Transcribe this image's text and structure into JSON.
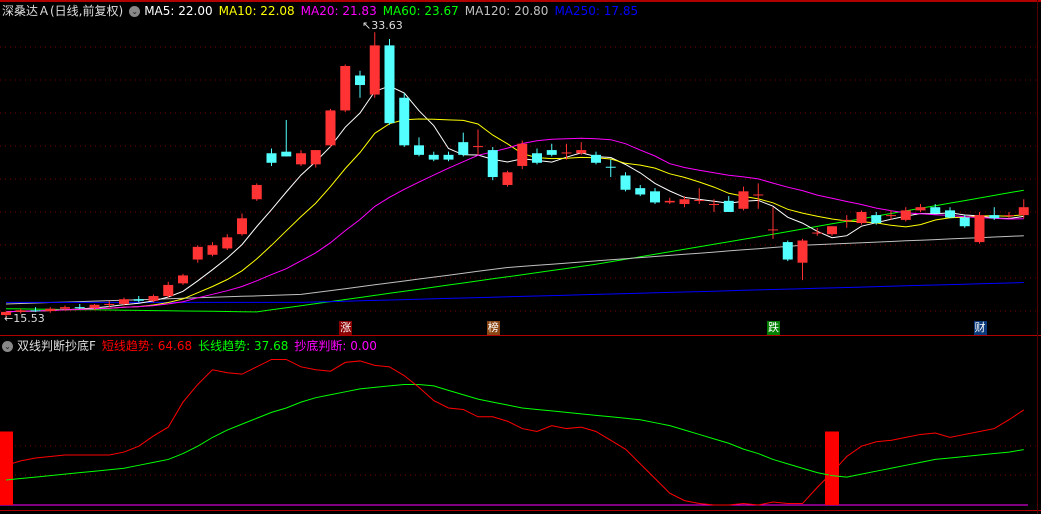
{
  "header": {
    "title": "深桑达Ａ(日线,前复权)",
    "ma": [
      {
        "label": "MA5: 22.00",
        "color": "#ffffff"
      },
      {
        "label": "MA10: 22.08",
        "color": "#ffff00"
      },
      {
        "label": "MA20: 21.83",
        "color": "#ff00ff"
      },
      {
        "label": "MA60: 23.67",
        "color": "#00ff00"
      },
      {
        "label": "MA120: 20.80",
        "color": "#c0c0c0"
      },
      {
        "label": "MA250: 17.85",
        "color": "#0000ff"
      }
    ]
  },
  "price_marks": {
    "high": "33.63",
    "low": "15.53"
  },
  "badges": [
    {
      "label": "涨",
      "color": "#8b0000",
      "index": 23
    },
    {
      "label": "榜",
      "color": "#8b4513",
      "index": 33
    },
    {
      "label": "跌",
      "color": "#008000",
      "index": 52
    },
    {
      "label": "财",
      "color": "#0a3a7a",
      "index": 66
    }
  ],
  "indicator": {
    "title": "双线判断抄底F",
    "short_label": "短线趋势: 64.68",
    "long_label": "长线趋势: 37.68",
    "bottom_label": "抄底判断: 0.00",
    "short_color": "#ff0000",
    "long_color": "#00ff00",
    "bottom_color": "#ff00ff"
  },
  "chart_data": {
    "type": "candlestick",
    "price_range": [
      15.3,
      34.4
    ],
    "candles": [
      [
        15.8,
        16.0,
        15.53,
        16.0
      ],
      [
        16.0,
        16.2,
        15.9,
        16.1
      ],
      [
        16.1,
        16.3,
        16.0,
        16.05
      ],
      [
        16.05,
        16.3,
        15.95,
        16.2
      ],
      [
        16.2,
        16.4,
        16.1,
        16.3
      ],
      [
        16.3,
        16.5,
        16.2,
        16.25
      ],
      [
        16.25,
        16.5,
        16.1,
        16.45
      ],
      [
        16.45,
        16.7,
        16.3,
        16.5
      ],
      [
        16.5,
        16.9,
        16.4,
        16.8
      ],
      [
        16.8,
        17.0,
        16.6,
        16.7
      ],
      [
        16.7,
        17.1,
        16.6,
        17.0
      ],
      [
        17.0,
        17.9,
        16.9,
        17.7
      ],
      [
        17.8,
        18.4,
        17.7,
        18.3
      ],
      [
        19.3,
        20.2,
        19.1,
        20.1
      ],
      [
        19.6,
        20.4,
        19.5,
        20.2
      ],
      [
        20.0,
        20.9,
        19.9,
        20.7
      ],
      [
        20.9,
        22.2,
        20.8,
        21.9
      ],
      [
        23.1,
        24.1,
        23.0,
        24.0
      ],
      [
        26.0,
        26.3,
        25.2,
        25.4
      ],
      [
        26.1,
        28.1,
        25.8,
        25.8
      ],
      [
        25.3,
        26.2,
        25.2,
        26.0
      ],
      [
        25.3,
        26.2,
        25.1,
        26.2
      ],
      [
        26.5,
        28.8,
        26.4,
        28.7
      ],
      [
        28.7,
        31.6,
        28.6,
        31.5
      ],
      [
        30.9,
        31.2,
        29.5,
        30.3
      ],
      [
        29.7,
        33.63,
        29.5,
        32.8
      ],
      [
        32.8,
        33.2,
        27.8,
        27.9
      ],
      [
        29.5,
        29.8,
        26.4,
        26.5
      ],
      [
        26.5,
        27.0,
        25.8,
        25.9
      ],
      [
        25.9,
        26.1,
        25.5,
        25.6
      ],
      [
        25.9,
        26.1,
        25.5,
        25.6
      ],
      [
        26.7,
        27.3,
        25.8,
        25.9
      ],
      [
        26.4,
        27.5,
        25.9,
        26.45
      ],
      [
        26.2,
        26.4,
        24.3,
        24.5
      ],
      [
        24.0,
        24.9,
        23.9,
        24.8
      ],
      [
        25.2,
        26.8,
        25.0,
        26.6
      ],
      [
        26.0,
        26.3,
        25.3,
        25.4
      ],
      [
        26.2,
        26.6,
        25.8,
        25.9
      ],
      [
        26.0,
        26.6,
        25.6,
        26.05
      ],
      [
        26.0,
        26.7,
        25.9,
        26.2
      ],
      [
        25.9,
        26.1,
        25.3,
        25.4
      ],
      [
        25.15,
        25.6,
        24.5,
        25.1
      ],
      [
        24.6,
        24.8,
        23.6,
        23.7
      ],
      [
        23.8,
        24.0,
        23.3,
        23.4
      ],
      [
        23.6,
        23.8,
        22.8,
        22.9
      ],
      [
        22.9,
        23.2,
        22.8,
        23.0
      ],
      [
        22.8,
        23.3,
        22.6,
        23.1
      ],
      [
        23.0,
        23.8,
        22.8,
        23.05
      ],
      [
        22.75,
        23.1,
        22.3,
        22.8
      ],
      [
        23.0,
        23.3,
        22.3,
        22.3
      ],
      [
        22.5,
        23.9,
        22.4,
        23.6
      ],
      [
        23.4,
        24.1,
        22.5,
        23.4
      ],
      [
        21.2,
        22.6,
        20.6,
        21.2
      ],
      [
        20.4,
        20.5,
        19.2,
        19.3
      ],
      [
        19.1,
        20.6,
        18.0,
        20.5
      ],
      [
        21.0,
        21.3,
        20.8,
        21.0
      ],
      [
        20.9,
        21.4,
        20.8,
        21.4
      ],
      [
        21.8,
        22.1,
        21.3,
        21.8
      ],
      [
        21.6,
        22.4,
        21.5,
        22.3
      ],
      [
        22.1,
        22.3,
        21.5,
        21.6
      ],
      [
        22.1,
        22.4,
        21.8,
        22.1
      ],
      [
        21.8,
        22.6,
        21.7,
        22.4
      ],
      [
        22.4,
        22.8,
        22.3,
        22.6
      ],
      [
        22.6,
        22.8,
        22.2,
        22.2
      ],
      [
        22.4,
        22.6,
        21.9,
        21.95
      ],
      [
        21.95,
        22.1,
        21.3,
        21.4
      ],
      [
        20.4,
        22.3,
        20.3,
        22.1
      ],
      [
        22.1,
        22.6,
        21.8,
        21.9
      ],
      [
        22.05,
        22.3,
        21.9,
        22.1
      ],
      [
        22.1,
        23.1,
        21.9,
        22.6
      ]
    ],
    "long_ma": [
      {
        "name": "MA60",
        "color": "#00ff00",
        "points": [
          [
            0,
            16.2
          ],
          [
            17,
            16.0
          ],
          [
            27,
            17.3
          ],
          [
            40,
            19.0
          ],
          [
            52,
            20.9
          ],
          [
            69,
            23.67
          ]
        ]
      },
      {
        "name": "MA120",
        "color": "#c0c0c0",
        "points": [
          [
            0,
            16.5
          ],
          [
            20,
            17.1
          ],
          [
            34,
            18.8
          ],
          [
            47,
            19.7
          ],
          [
            54,
            20.2
          ],
          [
            69,
            20.8
          ]
        ]
      },
      {
        "name": "MA250",
        "color": "#0000ff",
        "points": [
          [
            0,
            16.6
          ],
          [
            20,
            16.6
          ],
          [
            40,
            17.1
          ],
          [
            69,
            17.85
          ]
        ]
      }
    ],
    "indicator_range": [
      0,
      100
    ],
    "short_trend": [
      27,
      30,
      32,
      33,
      34,
      34,
      34,
      34,
      36,
      40,
      47,
      53,
      70,
      82,
      92,
      90,
      89,
      94,
      99,
      99,
      94,
      92,
      91,
      97,
      98,
      95,
      94,
      88,
      80,
      71,
      66,
      65,
      60,
      60,
      57,
      52,
      50,
      54,
      52,
      53,
      50,
      44,
      38,
      28,
      18,
      8,
      3,
      1,
      0,
      0,
      1,
      0,
      2,
      1,
      1,
      12,
      22,
      33,
      40,
      43,
      44,
      46,
      48,
      49,
      46,
      48,
      50,
      52,
      58,
      64.68
    ],
    "long_trend": [
      17,
      18,
      19,
      20,
      21,
      22,
      23,
      24,
      25,
      27,
      29,
      31,
      35,
      40,
      46,
      51,
      55,
      59,
      63,
      66,
      70,
      73,
      75,
      77,
      79,
      80,
      81,
      82,
      82,
      81,
      78,
      75,
      72,
      70,
      68,
      66,
      65,
      64,
      63,
      62,
      61,
      60,
      59,
      58,
      56,
      54,
      51,
      48,
      45,
      42,
      38,
      35,
      31,
      28,
      25,
      22,
      20,
      19,
      21,
      23,
      25,
      27,
      29,
      31,
      32,
      33,
      34,
      35,
      36,
      37.68
    ],
    "bottom_signals": [
      {
        "index": 0,
        "value": 50
      },
      {
        "index": 56,
        "value": 50
      }
    ]
  }
}
